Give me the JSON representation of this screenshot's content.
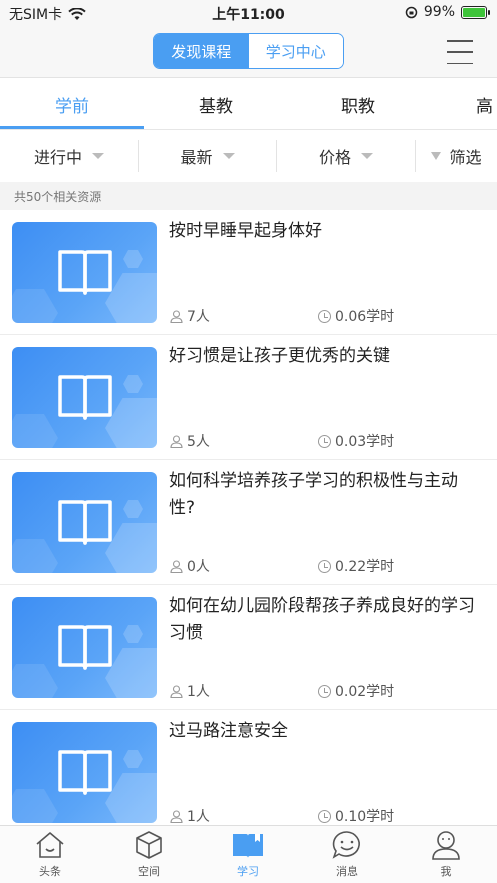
{
  "status_bar": {
    "carrier": "无SIM卡",
    "time": "上午11:00",
    "battery": "99%"
  },
  "header": {
    "segments": [
      {
        "label": "发现课程",
        "active": true
      },
      {
        "label": "学习中心",
        "active": false
      }
    ]
  },
  "categories": [
    {
      "label": "学前",
      "active": true
    },
    {
      "label": "基教",
      "active": false
    },
    {
      "label": "职教",
      "active": false
    },
    {
      "label": "高",
      "active": false
    }
  ],
  "filters": {
    "status": "进行中",
    "sort": "最新",
    "price": "价格",
    "screen": "筛选"
  },
  "count_text": "共50个相关资源",
  "courses": [
    {
      "title": "按时早睡早起身体好",
      "people": "7人",
      "hours": "0.06学时"
    },
    {
      "title": "好习惯是让孩子更优秀的关键",
      "people": "5人",
      "hours": "0.03学时"
    },
    {
      "title": "如何科学培养孩子学习的积极性与主动性?",
      "people": "0人",
      "hours": "0.22学时"
    },
    {
      "title": "如何在幼儿园阶段帮孩子养成良好的学习习惯",
      "people": "1人",
      "hours": "0.02学时"
    },
    {
      "title": "过马路注意安全",
      "people": "1人",
      "hours": "0.10学时"
    }
  ],
  "tabbar": [
    {
      "label": "头条",
      "icon": "home-icon",
      "active": false
    },
    {
      "label": "空间",
      "icon": "cube-icon",
      "active": false
    },
    {
      "label": "学习",
      "icon": "book-icon",
      "active": true
    },
    {
      "label": "消息",
      "icon": "chat-smile-icon",
      "active": false
    },
    {
      "label": "我",
      "icon": "user-icon",
      "active": false
    }
  ],
  "colors": {
    "accent": "#4a9ef2",
    "thumb": "#4a96f4"
  }
}
